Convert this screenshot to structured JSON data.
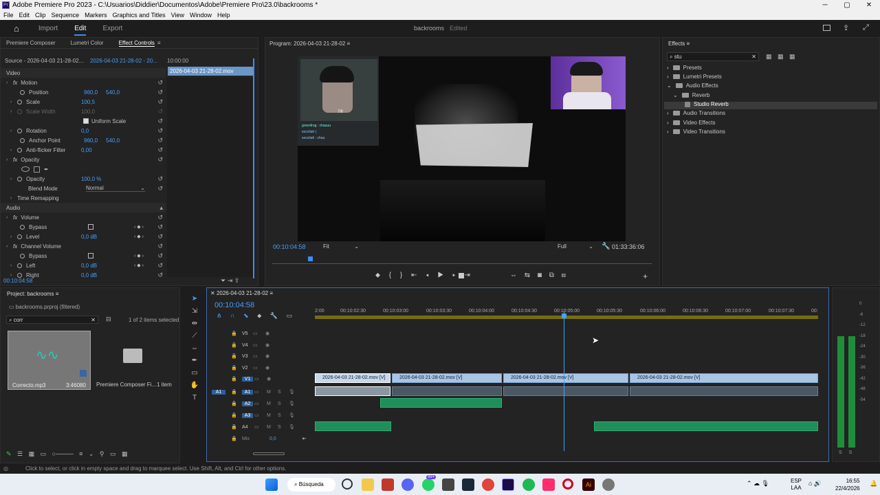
{
  "window": {
    "title": "Adobe Premiere Pro 2023 - C:\\Usuarios\\Diddier\\Documentos\\Adobe\\Premiere Pro\\23.0\\backrooms *",
    "min": "─",
    "max": "▢",
    "close": "✕"
  },
  "menu": [
    "File",
    "Edit",
    "Clip",
    "Sequence",
    "Markers",
    "Graphics and Titles",
    "View",
    "Window",
    "Help"
  ],
  "topbar": {
    "tabs": [
      "Import",
      "Edit",
      "Export"
    ],
    "project": "backrooms",
    "status": "Edited"
  },
  "effect_controls": {
    "tabs": [
      "Premiere Composer",
      "Lumetri Color",
      "Effect Controls"
    ],
    "source": "Source - 2026-04-03 21-28-02...",
    "target": "2026-04-03 21-28-02 - 20...",
    "timecode_start": "10:00:00",
    "clip_label": "2026-04-03 21-28-02.mov",
    "video_header": "Video",
    "motion": "Motion",
    "position_label": "Position",
    "position_x": "960,0",
    "position_y": "540,0",
    "scale_label": "Scale",
    "scale": "100,5",
    "scale_width_label": "Scale Width",
    "scale_width": "100,0",
    "uniform_scale": "Uniform Scale",
    "rotation_label": "Rotation",
    "rotation": "0,0",
    "anchor_label": "Anchor Point",
    "anchor_x": "960,0",
    "anchor_y": "540,0",
    "antiflicker_label": "Anti-flicker Filter",
    "antiflicker": "0,00",
    "opacity_header": "Opacity",
    "opacity_label": "Opacity",
    "opacity": "100,0 %",
    "blend_label": "Blend Mode",
    "blend": "Normal",
    "time_remap": "Time Remapping",
    "audio_header": "Audio",
    "volume": "Volume",
    "bypass": "Bypass",
    "level_label": "Level",
    "level": "0,0 dB",
    "channel_volume": "Channel Volume",
    "left_label": "Left",
    "left": "0,0 dB",
    "right_label": "Right",
    "right": "0,0 dB",
    "timecode": "00:10:04:58"
  },
  "program": {
    "title": "Program: 2026-04-03 21-28-02",
    "timecode": "00:10:04:58",
    "fit": "Fit",
    "quality": "Full",
    "duration": "01:33:36:06",
    "chat": [
      "greenfrog : chauuu",
      "soccitah (",
      "soccitah : chau"
    ],
    "webcam_caption": "7lfl"
  },
  "effects": {
    "title": "Effects",
    "search": "stu",
    "tree": [
      "Presets",
      "Lumetri Presets",
      "Audio Effects",
      "Reverb",
      "Studio Reverb",
      "Audio Transitions",
      "Video Effects",
      "Video Transitions"
    ]
  },
  "project": {
    "title": "Project: backrooms",
    "file": "backrooms.prproj (filtered)",
    "search": "corr",
    "selected": "1 of 2 items selected",
    "items": [
      {
        "name": "Correcto.mp3",
        "duration": "3:46080"
      },
      {
        "name": "Premiere Composer Fi...",
        "count": "1 item"
      }
    ]
  },
  "timeline": {
    "title": "2026-04-03 21-28-02",
    "timecode": "00:10:04:58",
    "ticks": [
      "2:00",
      "00:10:02:30",
      "00:10:03:00",
      "00:10:03:30",
      "00:10:04:00",
      "00:10:04:30",
      "00:10:05:00",
      "00:10:05:30",
      "00:10:06:00",
      "00:10:06:30",
      "00:10:07:00",
      "00:10:07:30",
      "00:"
    ],
    "video_tracks": [
      "V5",
      "V4",
      "V3",
      "V2",
      "V1"
    ],
    "audio_tracks": [
      "A1",
      "A2",
      "A3",
      "A4"
    ],
    "source_patch": "A1",
    "mix": "Mix",
    "mix_val": "0,0",
    "clip_name": "2026-04-03 21-28-02.mov [V]",
    "meter_scale": [
      "0",
      "-6",
      "-12",
      "-18",
      "-24",
      "-30",
      "-36",
      "-42",
      "-48",
      "-54"
    ],
    "meter_solo": [
      "S",
      "S"
    ]
  },
  "status": "Click to select, or click in empty space and drag to marquee select. Use Shift, Alt, and Ctrl for other options.",
  "taskbar": {
    "search": "Búsqueda",
    "lang1": "ESP",
    "lang2": "LAA",
    "time": "16:55",
    "date": "22/4/2026",
    "badge": "99+"
  }
}
